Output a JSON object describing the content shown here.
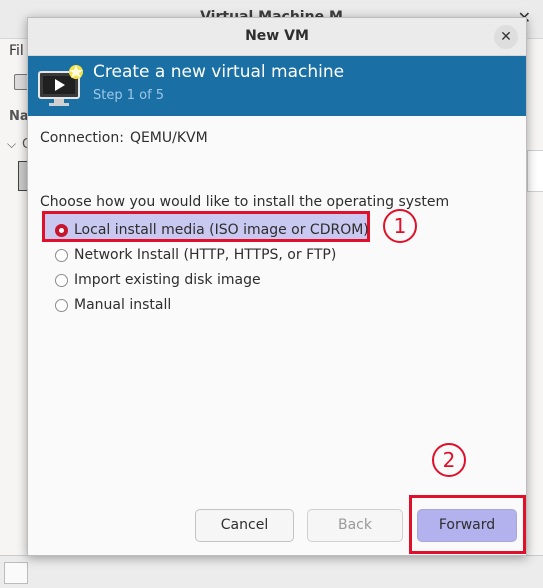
{
  "background_window": {
    "title": "Virtual Machine M",
    "menu_partial": "Fil",
    "list_header_partial": "Na",
    "group_partial": "Q"
  },
  "dialog": {
    "title": "New VM",
    "banner": {
      "title": "Create a new virtual machine",
      "step": "Step 1 of 5"
    },
    "connection": {
      "label": "Connection:",
      "value": "QEMU/KVM"
    },
    "install_prompt": "Choose how you would like to install the operating system",
    "install_options": [
      {
        "label": "Local install media (ISO image or CDROM)",
        "selected": true
      },
      {
        "label": "Network Install (HTTP, HTTPS, or FTP)",
        "selected": false
      },
      {
        "label": "Import existing disk image",
        "selected": false
      },
      {
        "label": "Manual install",
        "selected": false
      }
    ],
    "buttons": {
      "cancel": "Cancel",
      "back": "Back",
      "forward": "Forward"
    }
  },
  "annotations": {
    "step1": "1",
    "step2": "2"
  },
  "colors": {
    "banner": "#1a70a5",
    "annotation": "#e0102a",
    "highlight_fill": "#c8c8f0",
    "radio_selected": "#c7162b"
  },
  "icons": {
    "banner_icon": "vm-monitor-play-icon",
    "close_icon": "close-icon"
  }
}
